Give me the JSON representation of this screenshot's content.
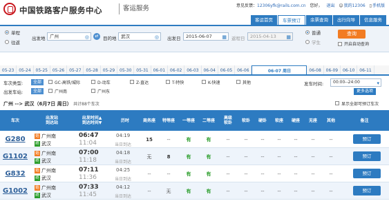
{
  "header": {
    "title": "中国铁路客户服务中心",
    "subtitle": "客运服务",
    "feedback_label": "意见反馈：",
    "feedback_email": "12306yfk@rails.com.cn",
    "greeting": "您好，",
    "user": "",
    "logout": "退出",
    "my12306": "我的12306",
    "mobile": "手机版"
  },
  "nav": [
    "客运首页",
    "车票预订",
    "余票查询",
    "出行向导",
    "信息服务"
  ],
  "search": {
    "one_way": "单程",
    "round_trip": "往返",
    "from_label": "出发地",
    "from_value": "广州",
    "to_label": "目的地",
    "to_value": "武汉",
    "depart_label": "出发日",
    "depart_value": "2015-06-07",
    "return_label": "返程日",
    "return_value": "2015-04-13",
    "normal": "普通",
    "student": "学生",
    "query_button": "查询",
    "auto_query": "开启自动查询"
  },
  "dates": [
    "05-23",
    "05-24",
    "05-25",
    "05-26",
    "05-27",
    "05-28",
    "05-29",
    "05-30",
    "05-31",
    "06-01",
    "06-02",
    "06-03",
    "06-04",
    "06-05",
    "06-06",
    "06-07 周日",
    "06-08",
    "06-09",
    "06-10",
    "06-11"
  ],
  "active_date_index": 15,
  "filters": {
    "type_label": "车次类型:",
    "all": "全部",
    "types": [
      "GC-高铁/城际",
      "D-动车",
      "Z-直达",
      "T-特快",
      "K-快速",
      "其他"
    ],
    "station_label": "出发车站:",
    "stations": [
      "广州南",
      "广州东"
    ],
    "time_label": "发车时间:",
    "time_value": "00:00--24:00",
    "more": "更多选项"
  },
  "route": {
    "text": "广州 --> 武汉（6月7日 周日）",
    "count": "共计88个车次",
    "show_all": "显示全部可预订车次"
  },
  "table": {
    "headers": [
      "车次",
      "出发站\n到达站",
      "出发时间▲\n到达时间▼",
      "历时",
      "商务座",
      "特等座",
      "一等座",
      "二等座",
      "高级\n软卧",
      "软卧",
      "硬卧",
      "软座",
      "硬座",
      "无座",
      "其他",
      "备注"
    ],
    "rows": [
      {
        "train": "G280",
        "from": "广州南",
        "to": "武汉",
        "dep": "06:47",
        "arr": "11:04",
        "dur": "04:19",
        "day": "当日到达",
        "seats": [
          "15",
          "--",
          "有",
          "有",
          "--",
          "--",
          "--",
          "--",
          "--",
          "--",
          "--"
        ],
        "book": "预订"
      },
      {
        "train": "G1102",
        "from": "广州南",
        "to": "武汉",
        "dep": "07:00",
        "arr": "11:18",
        "dur": "04:18",
        "day": "当日到达",
        "seats": [
          "无",
          "8",
          "有",
          "有",
          "--",
          "--",
          "--",
          "--",
          "--",
          "--",
          "--"
        ],
        "book": "预订"
      },
      {
        "train": "G832",
        "from": "广州南",
        "to": "武汉",
        "dep": "07:11",
        "arr": "11:36",
        "dur": "04:25",
        "day": "当日到达",
        "seats": [
          "--",
          "--",
          "有",
          "有",
          "--",
          "--",
          "--",
          "--",
          "--",
          "--",
          "--"
        ],
        "book": "预订"
      },
      {
        "train": "G1002",
        "from": "广州南",
        "to": "武汉",
        "dep": "07:33",
        "arr": "11:45",
        "dur": "04:12",
        "day": "当日到达",
        "seats": [
          "--",
          "无",
          "有",
          "有",
          "--",
          "--",
          "--",
          "--",
          "--",
          "--",
          "--"
        ],
        "book": "预订"
      }
    ]
  },
  "colors": {
    "primary": "#2d7bc1",
    "accent": "#f27c22",
    "brand": "#c8161d",
    "available": "#2a9d2a"
  }
}
